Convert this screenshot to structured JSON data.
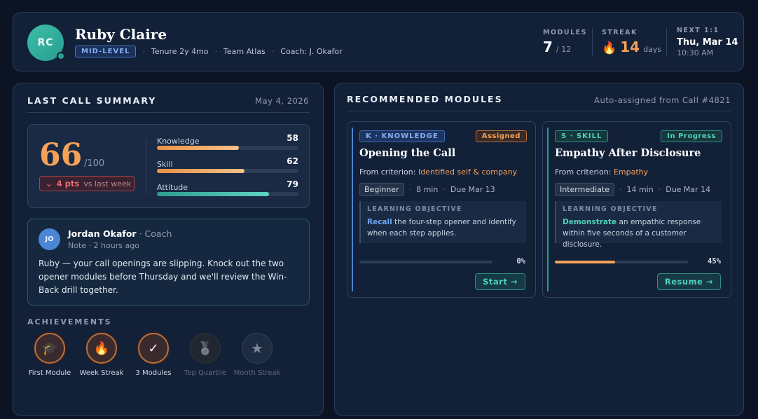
{
  "profile": {
    "initials": "RC",
    "name": "Ruby Claire",
    "level": "MID-LEVEL",
    "tenure": "Tenure 2y 4mo",
    "team": "Team Atlas",
    "coach": "Coach: J. Okafor"
  },
  "stats": {
    "modules_label": "MODULES",
    "modules_value": "7",
    "modules_total": "/ 12",
    "streak_label": "STREAK",
    "streak_icon": "🔥",
    "streak_value": "14",
    "streak_unit": "days",
    "next_label": "NEXT 1:1",
    "next_date": "Thu, Mar 14",
    "next_time": "10:30 AM"
  },
  "summary": {
    "title": "LAST CALL SUMMARY",
    "date": "May 4, 2026",
    "score": "66",
    "score_of": "/100",
    "delta_icon": "⌄",
    "delta": "4 pts",
    "delta_vs": "vs last week",
    "metrics": [
      {
        "label": "Knowledge",
        "value": "58",
        "fraction": 0.58
      },
      {
        "label": "Skill",
        "value": "62",
        "fraction": 0.62
      },
      {
        "label": "Attitude",
        "value": "79",
        "fraction": 0.79
      }
    ]
  },
  "note": {
    "initials": "JO",
    "author": "Jordan Okafor",
    "role": " · Coach",
    "time": "Note · 2 hours ago",
    "text": "Ruby — your call openings are slipping. Knock out the two opener modules before Thursday and we'll review the Win-Back drill together."
  },
  "achievements": {
    "title": "ACHIEVEMENTS",
    "items": [
      {
        "label": "First Module",
        "icon": "🎓",
        "earned": true
      },
      {
        "label": "Week Streak",
        "icon": "🔥",
        "earned": true
      },
      {
        "label": "3 Modules",
        "icon": "✓",
        "earned": true
      },
      {
        "label": "Top Quartile",
        "icon": "🏅",
        "earned": false
      },
      {
        "label": "Month Streak",
        "icon": "★",
        "earned": false
      }
    ]
  },
  "recommended": {
    "title": "RECOMMENDED MODULES",
    "subtitle": "Auto-assigned from Call #4821",
    "cards": [
      {
        "tag": "K · KNOWLEDGE",
        "status": "Assigned",
        "title": "Opening the Call",
        "criterion_prefix": "From criterion: ",
        "criterion": "Identified self & company",
        "level": "Beginner",
        "duration": "8 min",
        "due": "Due Mar 13",
        "objective_label": "LEARNING OBJECTIVE",
        "objective_verb": "Recall",
        "objective_text": " the four-step opener and identify when each step applies.",
        "progress": 0,
        "progress_label": "0%",
        "button": "Start →",
        "accent": "#4a85d6"
      },
      {
        "tag": "S · SKILL",
        "status": "In Progress",
        "title": "Empathy After Disclosure",
        "criterion_prefix": "From criterion: ",
        "criterion": "Empathy",
        "level": "Intermediate",
        "duration": "14 min",
        "due": "Due Mar 14",
        "objective_label": "LEARNING OBJECTIVE",
        "objective_verb": "Demonstrate",
        "objective_text": " an empathic response within five seconds of a customer disclosure.",
        "progress": 0.45,
        "progress_label": "45%",
        "button": "Resume →",
        "accent": "#2a9d8f"
      }
    ]
  }
}
